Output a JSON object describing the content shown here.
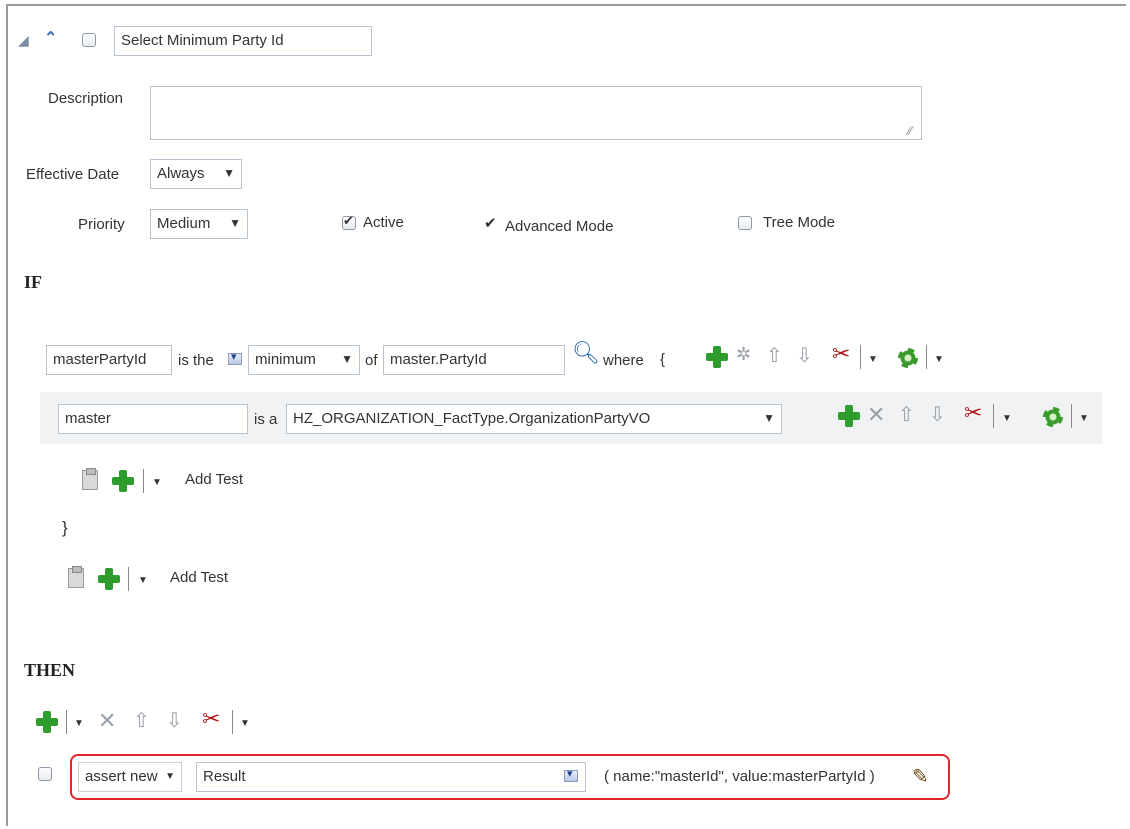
{
  "rule": {
    "name": "Select Minimum Party Id",
    "description_label": "Description",
    "description_value": "",
    "effective_date_label": "Effective Date",
    "effective_date_value": "Always",
    "priority_label": "Priority",
    "priority_value": "Medium",
    "active_label": "Active",
    "advanced_mode_label": "Advanced Mode",
    "tree_mode_label": "Tree Mode"
  },
  "if_section": {
    "heading": "IF",
    "variable": "masterPartyId",
    "is_the": "is the",
    "aggregate": "minimum",
    "of": "of",
    "of_expr": "master.PartyId",
    "where": "where",
    "open_brace": "{",
    "close_brace": "}",
    "fact_var": "master",
    "is_a": "is a",
    "fact_type": "HZ_ORGANIZATION_FactType.OrganizationPartyVO",
    "add_test_inner": "Add Test",
    "add_test_outer": "Add Test"
  },
  "then_section": {
    "heading": "THEN",
    "action": "assert new",
    "target": "Result",
    "args": "( name:\"masterId\", value:masterPartyId )"
  },
  "colors": {
    "highlight": "#e0242c",
    "plus_green": "#2e9d2e",
    "row_band": "#f0f2f4"
  },
  "icons": [
    "expand-triangle-icon",
    "collapse-double-chevron-icon",
    "search-magnifier-icon",
    "plus-icon",
    "delete-icon",
    "up-arrow-icon",
    "down-arrow-icon",
    "cut-scissors-icon",
    "gear-icon",
    "paste-clipboard-icon",
    "edit-pencil-icon"
  ]
}
